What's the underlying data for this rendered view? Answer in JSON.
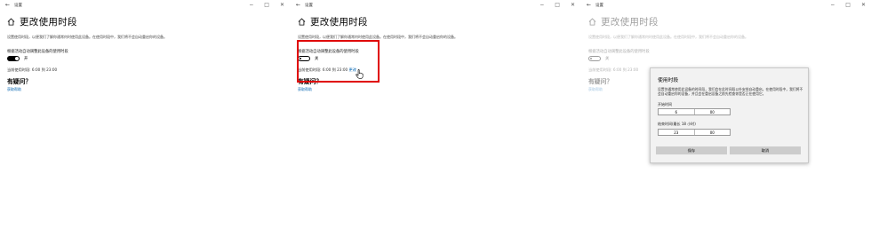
{
  "window": {
    "back": "←",
    "title": "设置",
    "controls": [
      "−",
      "□",
      "✕"
    ]
  },
  "page": {
    "title": "更改使用时段",
    "description": "设置使用时段，以便我们了解你通常何时使用此设备。在使用时段中，我们将不会自动重启你的设备。",
    "auto_adjust_label": "根据活动自动调整此设备的使用时段",
    "current_hours": "当前使用时段: 6:00 到 23:00",
    "change_link": "更改",
    "question": "有疑问？",
    "help_link": "获取帮助"
  },
  "panels": [
    {
      "toggle_on": true,
      "toggle_state": "开",
      "show_change_link": false
    },
    {
      "toggle_on": false,
      "toggle_state": "关",
      "show_change_link": true
    },
    {
      "toggle_on": false,
      "toggle_state": "关",
      "show_change_link": false
    }
  ],
  "dialog": {
    "title": "使用时段",
    "description": "设置你通常使用此设备的时间段，我们会在此时间段以外安排自动重启。在使用时段中，我们将不会自动重启你的设备，并且会在重启设备之前先检查你是否正在使用它。",
    "start_label": "开始时间",
    "start_hour": "6",
    "start_minute": "00",
    "end_label": "结束时间(最长 18 小时)",
    "end_hour": "23",
    "end_minute": "00",
    "save": "保存",
    "cancel": "取消"
  },
  "colors": {
    "highlight": "#e00000",
    "link": "#0063b1"
  },
  "icons": {
    "back": "back-arrow-icon",
    "home": "home-icon",
    "cursor": "pointer-hand-icon"
  }
}
